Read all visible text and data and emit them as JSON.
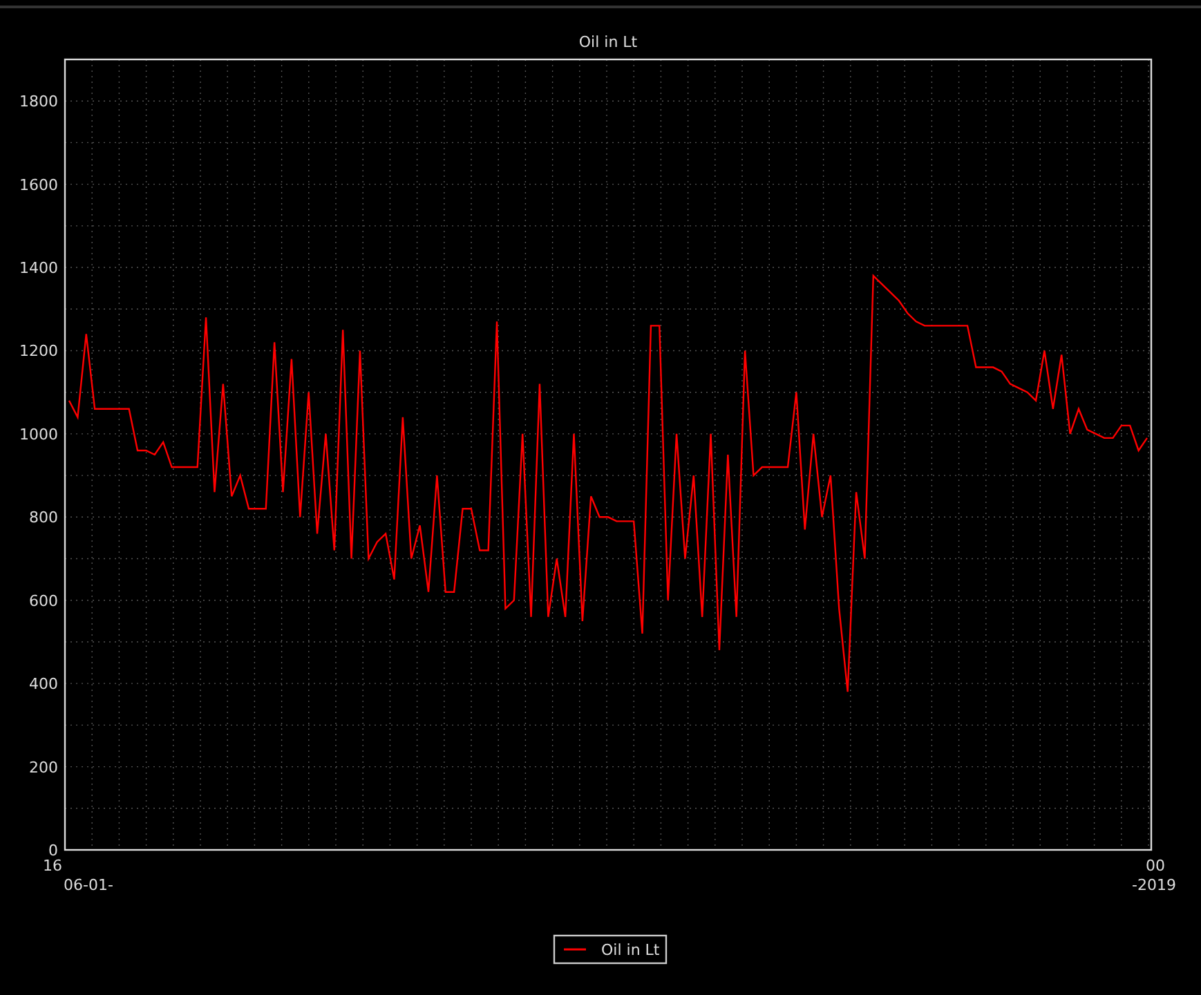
{
  "chart": {
    "chart_data": {
      "type": "line",
      "title": "Oil in Lt",
      "ylim": [
        0,
        1900
      ],
      "yticks": [
        0,
        200,
        400,
        600,
        800,
        1000,
        1200,
        1400,
        1600,
        1800
      ],
      "grid": true,
      "series": [
        {
          "name": "Oil in Lt",
          "color": "#ff0000",
          "values": [
            1080,
            1040,
            1240,
            1060,
            1060,
            1060,
            1060,
            1060,
            960,
            960,
            950,
            980,
            920,
            920,
            920,
            920,
            1280,
            860,
            1120,
            850,
            900,
            820,
            820,
            820,
            1220,
            860,
            1180,
            800,
            1100,
            760,
            1000,
            720,
            1250,
            700,
            1200,
            700,
            740,
            760,
            650,
            1040,
            700,
            780,
            620,
            900,
            620,
            620,
            820,
            820,
            720,
            720,
            1270,
            580,
            600,
            1000,
            560,
            1120,
            560,
            700,
            560,
            1000,
            550,
            850,
            800,
            800,
            790,
            790,
            790,
            520,
            1260,
            1260,
            600,
            1000,
            700,
            900,
            560,
            1000,
            480,
            950,
            560,
            1200,
            900,
            920,
            920,
            920,
            920,
            1100,
            770,
            1000,
            800,
            900,
            580,
            380,
            860,
            700,
            1380,
            1360,
            1340,
            1320,
            1290,
            1270,
            1260,
            1260,
            1260,
            1260,
            1260,
            1260,
            1160,
            1160,
            1160,
            1150,
            1120,
            1110,
            1100,
            1080,
            1200,
            1060,
            1190,
            1000,
            1060,
            1010,
            1000,
            990,
            990,
            1020,
            1020,
            960,
            990
          ]
        }
      ]
    },
    "x_edge_labels": [
      "16",
      "00"
    ],
    "x_date_labels": [
      "06-01-",
      "-2019"
    ]
  }
}
